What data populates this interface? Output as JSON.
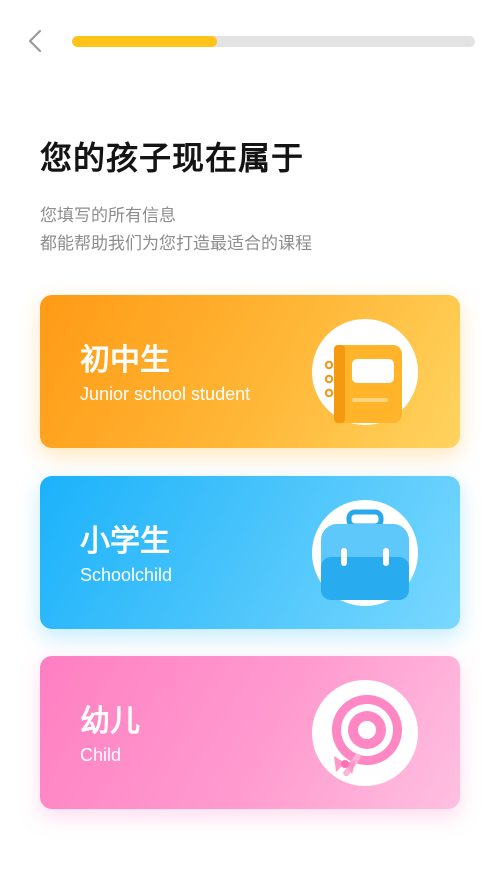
{
  "header": {
    "back_icon": "chevron-left-icon",
    "progress": 0.36,
    "progress_color": "#ffc31a",
    "track_color": "#e3e3e3"
  },
  "title": "您的孩子现在属于",
  "subtitle": {
    "line1": "您填写的所有信息",
    "line2": "都能帮助我们为您打造最适合的课程"
  },
  "options": [
    {
      "name": "初中生",
      "english": "Junior school student",
      "icon": "notebook-icon",
      "color": "#ffa623"
    },
    {
      "name": "小学生",
      "english": "Schoolchild",
      "icon": "schoolbag-icon",
      "color": "#27b7fa"
    },
    {
      "name": "幼儿",
      "english": "Child",
      "icon": "lollipop-icon",
      "color": "#ff8ac6"
    }
  ]
}
